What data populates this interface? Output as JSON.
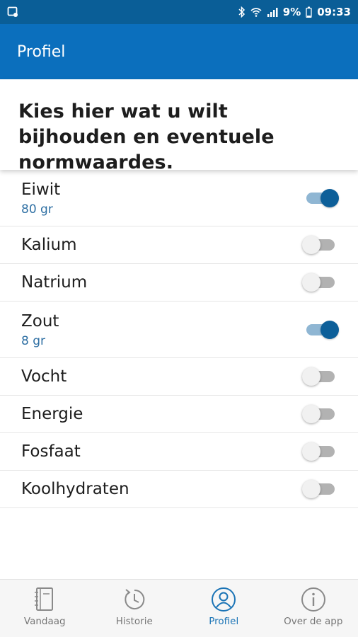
{
  "statusbar": {
    "battery": "9%",
    "time": "09:33"
  },
  "header": {
    "title": "Profiel"
  },
  "intro": {
    "text": "Kies hier wat u wilt bijhouden en eventuele normwaardes."
  },
  "items": [
    {
      "name": "Eiwit",
      "value": "80 gr",
      "enabled": true
    },
    {
      "name": "Kalium",
      "enabled": false
    },
    {
      "name": "Natrium",
      "enabled": false
    },
    {
      "name": "Zout",
      "value": "8 gr",
      "enabled": true
    },
    {
      "name": "Vocht",
      "enabled": false
    },
    {
      "name": "Energie",
      "enabled": false
    },
    {
      "name": "Fosfaat",
      "enabled": false
    },
    {
      "name": "Koolhydraten",
      "enabled": false
    }
  ],
  "nav": [
    {
      "label": "Vandaag",
      "icon": "notebook-icon",
      "active": false
    },
    {
      "label": "Historie",
      "icon": "history-icon",
      "active": false
    },
    {
      "label": "Profiel",
      "icon": "profile-icon",
      "active": true
    },
    {
      "label": "Over de app",
      "icon": "info-icon",
      "active": false
    }
  ],
  "colors": {
    "statusbar": "#0a5e97",
    "appbar": "#0b6fbd",
    "accent": "#0d5f99"
  }
}
